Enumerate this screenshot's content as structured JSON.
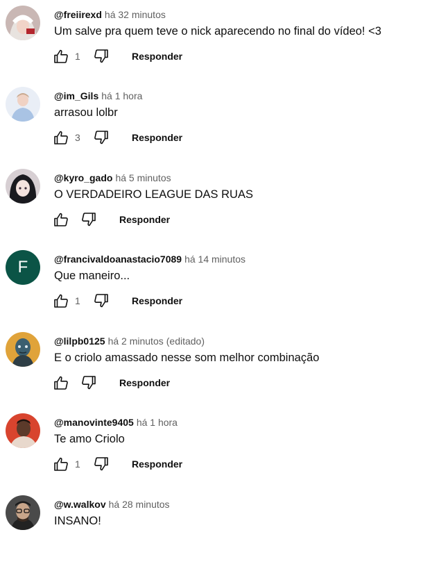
{
  "comments": [
    {
      "author": "@freiirexd",
      "time": "há 32 minutos",
      "edited": "",
      "text": "Um salve pra quem teve o nick aparecendo no final do vídeo! <3",
      "likes": "1",
      "reply_label": "Responder",
      "avatar": {
        "type": "image",
        "icon": "avatar-anime-white-hair",
        "bg": "#c9b7b4",
        "accent": "#e8e3df"
      }
    },
    {
      "author": "@im_Gils",
      "time": "há 1 hora",
      "edited": "",
      "text": "arrasou lolbr",
      "likes": "3",
      "reply_label": "Responder",
      "avatar": {
        "type": "image",
        "icon": "avatar-person-blue",
        "bg": "#e9eef6",
        "accent": "#a9c3e4"
      }
    },
    {
      "author": "@kyro_gado",
      "time": "há 5 minutos",
      "edited": "",
      "text": "O VERDADEIRO LEAGUE DAS RUAS",
      "likes": "",
      "reply_label": "Responder",
      "avatar": {
        "type": "image",
        "icon": "avatar-anime-dark-hair",
        "bg": "#d7cfd3",
        "accent": "#1a1a1f"
      }
    },
    {
      "author": "@francivaldoanastacio7089",
      "time": "há 14 minutos",
      "edited": "",
      "text": "Que maneiro...",
      "likes": "1",
      "reply_label": "Responder",
      "avatar": {
        "type": "letter",
        "letter": "F",
        "bg": "#0b5446"
      }
    },
    {
      "author": "@lilpb0125",
      "time": "há 2 minutos",
      "edited": "(editado)",
      "text": "E o criolo amassado nesse som melhor combinação",
      "likes": "",
      "reply_label": "Responder",
      "avatar": {
        "type": "image",
        "icon": "avatar-game-character",
        "bg": "#e0a33a",
        "accent": "#3c5f70"
      }
    },
    {
      "author": "@manovinte9405",
      "time": "há 1 hora",
      "edited": "",
      "text": "Te amo Criolo",
      "likes": "1",
      "reply_label": "Responder",
      "avatar": {
        "type": "image",
        "icon": "avatar-person-red",
        "bg": "#d8442e",
        "accent": "#5b3a2a"
      }
    },
    {
      "author": "@w.walkov",
      "time": "há 28 minutos",
      "edited": "",
      "text": "INSANO!",
      "likes": "",
      "reply_label": "",
      "avatar": {
        "type": "image",
        "icon": "avatar-person-glasses",
        "bg": "#4a4a4a",
        "accent": "#c8a58a"
      }
    }
  ]
}
